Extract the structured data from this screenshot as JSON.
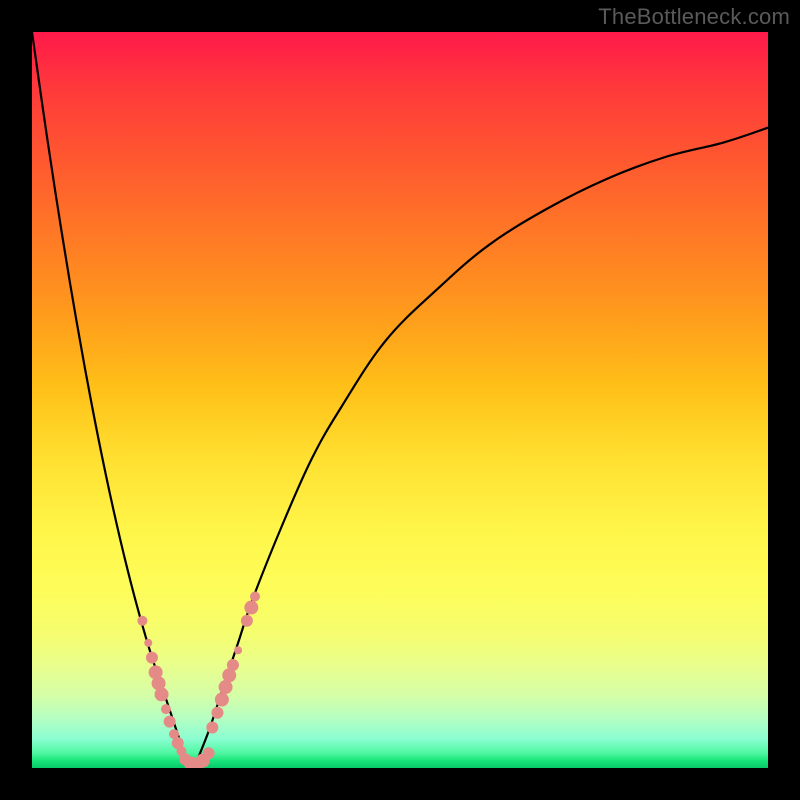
{
  "watermark": "TheBottleneck.com",
  "colors": {
    "frame": "#000000",
    "curve": "#000000",
    "marker": "#e58b87",
    "gradient_top": "#ff1a4a",
    "gradient_bottom": "#08c96a"
  },
  "chart_data": {
    "type": "line",
    "title": "",
    "xlabel": "",
    "ylabel": "",
    "xlim": [
      0,
      100
    ],
    "ylim": [
      0,
      100
    ],
    "optimum_x": 22,
    "left_curve": {
      "x": [
        0,
        2,
        4,
        6,
        8,
        10,
        12,
        14,
        16,
        18,
        20,
        21,
        22
      ],
      "y": [
        100,
        86,
        73,
        61,
        50,
        40,
        31,
        23,
        16,
        10,
        4,
        1,
        0
      ]
    },
    "right_curve": {
      "x": [
        22,
        24,
        26,
        28,
        30,
        34,
        38,
        42,
        48,
        55,
        62,
        70,
        78,
        86,
        94,
        100
      ],
      "y": [
        0,
        5,
        11,
        17,
        23,
        33,
        42,
        49,
        58,
        65,
        71,
        76,
        80,
        83,
        85,
        87
      ]
    },
    "markers_left": [
      {
        "x": 15.0,
        "y": 20.0,
        "r": 5
      },
      {
        "x": 15.8,
        "y": 17.0,
        "r": 4
      },
      {
        "x": 16.3,
        "y": 15.0,
        "r": 6
      },
      {
        "x": 16.8,
        "y": 13.0,
        "r": 7
      },
      {
        "x": 17.2,
        "y": 11.5,
        "r": 7
      },
      {
        "x": 17.6,
        "y": 10.0,
        "r": 7
      },
      {
        "x": 18.2,
        "y": 8.0,
        "r": 5
      },
      {
        "x": 18.7,
        "y": 6.3,
        "r": 6
      },
      {
        "x": 19.3,
        "y": 4.6,
        "r": 5
      },
      {
        "x": 19.8,
        "y": 3.4,
        "r": 6
      },
      {
        "x": 20.3,
        "y": 2.3,
        "r": 5
      }
    ],
    "markers_right": [
      {
        "x": 24.5,
        "y": 5.5,
        "r": 6
      },
      {
        "x": 25.2,
        "y": 7.5,
        "r": 6
      },
      {
        "x": 25.8,
        "y": 9.3,
        "r": 7
      },
      {
        "x": 26.3,
        "y": 11.0,
        "r": 7
      },
      {
        "x": 26.8,
        "y": 12.6,
        "r": 7
      },
      {
        "x": 27.3,
        "y": 14.0,
        "r": 6
      },
      {
        "x": 28.0,
        "y": 16.0,
        "r": 4
      },
      {
        "x": 29.2,
        "y": 20.0,
        "r": 6
      },
      {
        "x": 29.8,
        "y": 21.8,
        "r": 7
      },
      {
        "x": 30.3,
        "y": 23.3,
        "r": 5
      }
    ],
    "markers_bottom": [
      {
        "x": 20.8,
        "y": 1.2,
        "r": 6
      },
      {
        "x": 21.6,
        "y": 0.6,
        "r": 7
      },
      {
        "x": 22.4,
        "y": 0.5,
        "r": 7
      },
      {
        "x": 23.2,
        "y": 1.0,
        "r": 7
      },
      {
        "x": 24.0,
        "y": 2.0,
        "r": 6
      }
    ]
  }
}
